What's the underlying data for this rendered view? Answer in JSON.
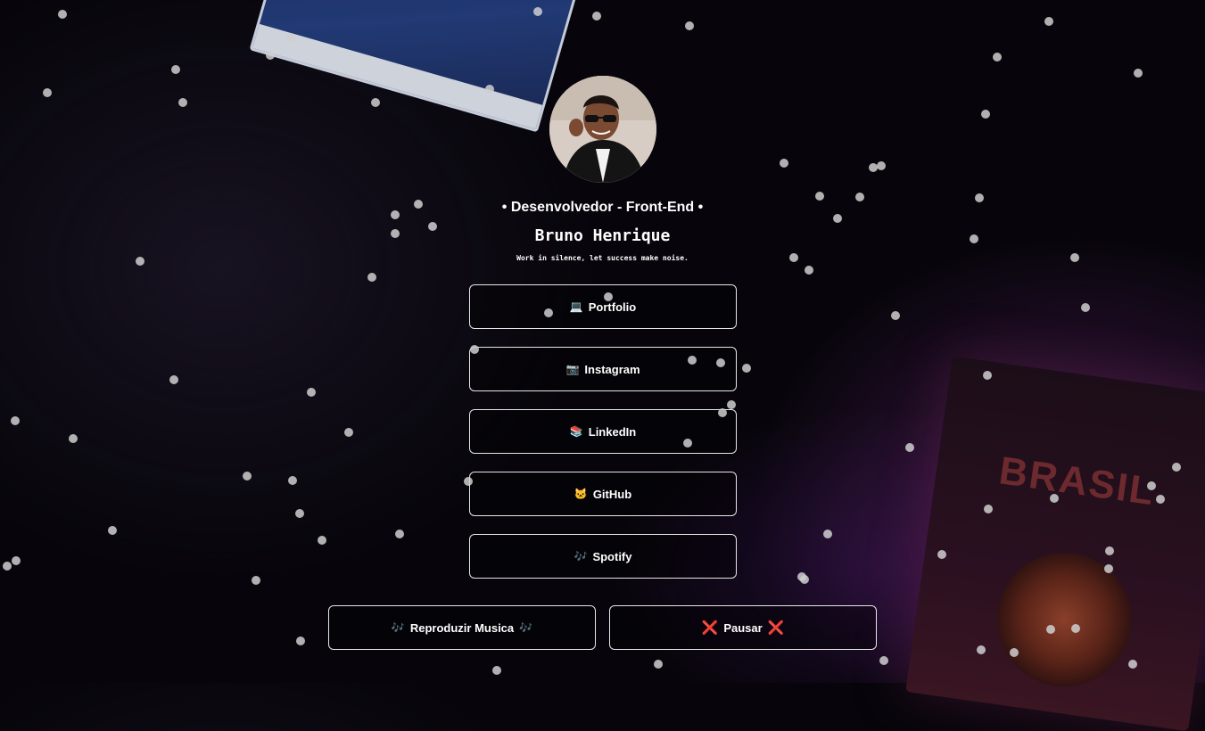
{
  "profile": {
    "role": "• Desenvolvedor - Front-End •",
    "name": "Bruno Henrique",
    "motto": "Work in silence, let success make noise."
  },
  "links": [
    {
      "label": "Portfolio",
      "icon": "laptop-icon",
      "glyph": "💻"
    },
    {
      "label": "Instagram",
      "icon": "camera-icon",
      "glyph": "📷"
    },
    {
      "label": "LinkedIn",
      "icon": "books-icon",
      "glyph": "📚"
    },
    {
      "label": "GitHub",
      "icon": "cat-icon",
      "glyph": "🐱"
    },
    {
      "label": "Spotify",
      "icon": "music-notes-icon",
      "glyph": "🎶"
    }
  ],
  "music": {
    "play_label": "Reproduzir Musica",
    "play_icon": "music-notes-icon",
    "play_glyph": "🎶",
    "pause_label": "Pausar",
    "pause_icon": "cross-mark-icon",
    "pause_glyph": "❌"
  },
  "background": {
    "passport_text": "BRASIL"
  },
  "colors": {
    "background": "#07050b",
    "button_border": "#e6e6e6",
    "text": "#ffffff",
    "accent_purple": "#6e2878",
    "pause_icon": "#e8333d"
  }
}
